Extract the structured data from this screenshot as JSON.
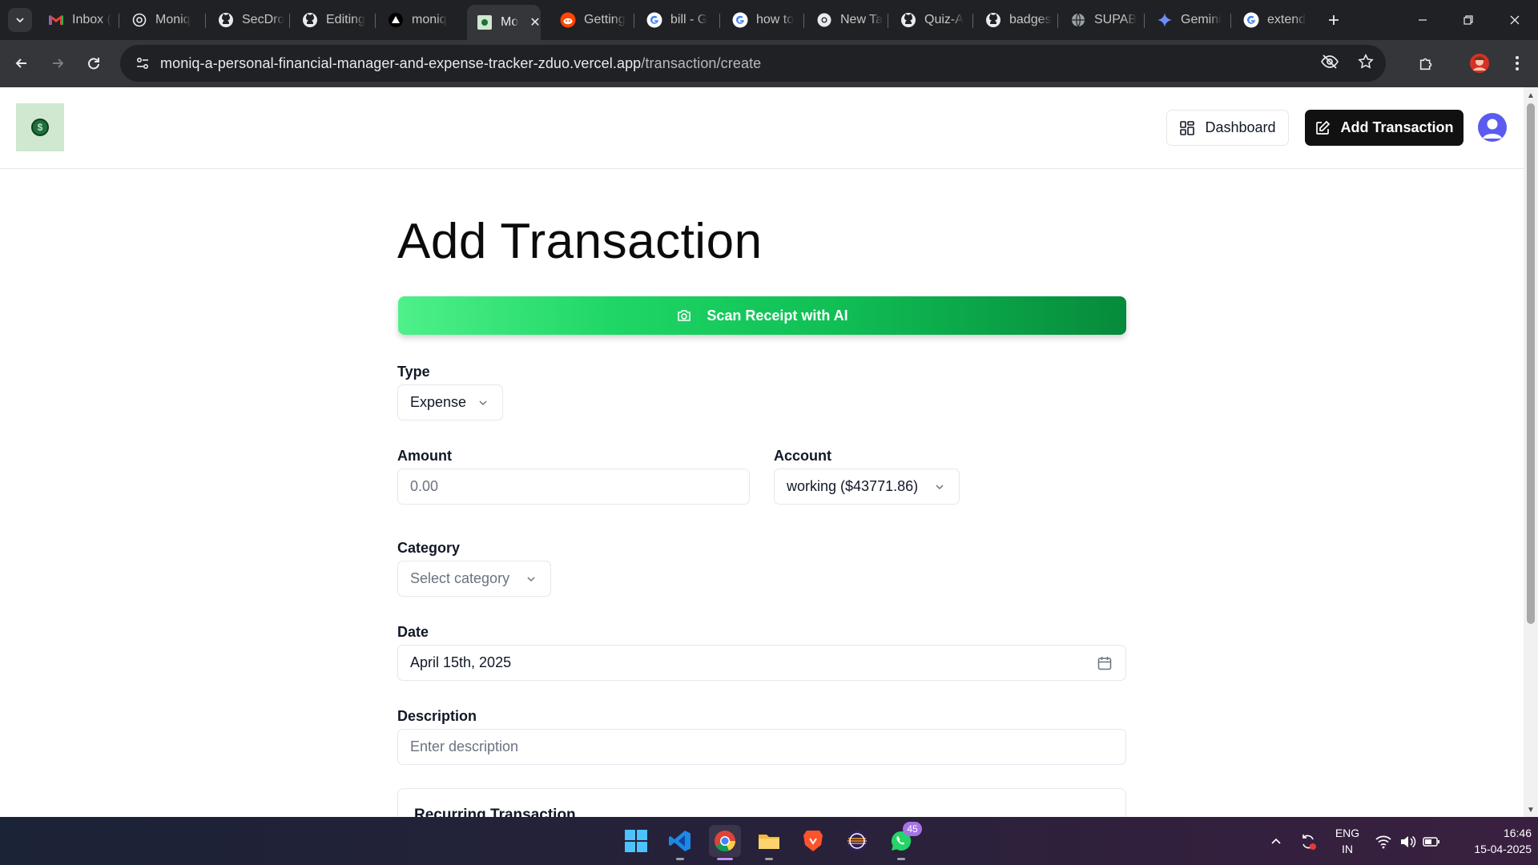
{
  "browser": {
    "tabs": [
      {
        "label": "Inbox (",
        "icon": "gmail-icon",
        "active": false
      },
      {
        "label": "Moniq",
        "icon": "openai-icon",
        "active": false
      },
      {
        "label": "SecDro",
        "icon": "github-icon",
        "active": false
      },
      {
        "label": "Editing",
        "icon": "github-icon",
        "active": false
      },
      {
        "label": "moniq",
        "icon": "vercel-icon",
        "active": false
      },
      {
        "label": "Mo",
        "icon": "moniq-favicon-icon",
        "active": true
      },
      {
        "label": "Getting",
        "icon": "reddit-icon",
        "active": false
      },
      {
        "label": "bill - G",
        "icon": "google-icon",
        "active": false
      },
      {
        "label": "how to",
        "icon": "google-icon",
        "active": false
      },
      {
        "label": "New Ta",
        "icon": "chrome-icon",
        "active": false
      },
      {
        "label": "Quiz-A",
        "icon": "github-icon",
        "active": false
      },
      {
        "label": "badges",
        "icon": "github-icon",
        "active": false
      },
      {
        "label": "SUPAB",
        "icon": "globe-icon",
        "active": false
      },
      {
        "label": "Gemini",
        "icon": "gemini-icon",
        "active": false
      },
      {
        "label": "extend",
        "icon": "google-icon",
        "active": false
      }
    ],
    "url_host": "moniq-a-personal-financial-manager-and-expense-tracker-zduo.vercel.app",
    "url_path": "/transaction/create"
  },
  "header": {
    "dashboard_label": "Dashboard",
    "add_transaction_label": "Add Transaction"
  },
  "form": {
    "title": "Add Transaction",
    "scan_label": "Scan Receipt with AI",
    "type_label": "Type",
    "type_value": "Expense",
    "amount_label": "Amount",
    "amount_placeholder": "0.00",
    "account_label": "Account",
    "account_value": "working ($43771.86)",
    "category_label": "Category",
    "category_placeholder": "Select category",
    "date_label": "Date",
    "date_value": "April 15th, 2025",
    "description_label": "Description",
    "description_placeholder": "Enter description",
    "recurring_title": "Recurring Transaction"
  },
  "taskbar": {
    "whatsapp_badge": "45",
    "lang_primary": "ENG",
    "lang_secondary": "IN",
    "time": "16:46",
    "date": "15-04-2025"
  }
}
